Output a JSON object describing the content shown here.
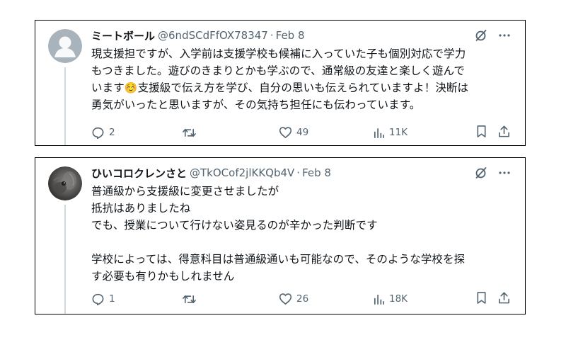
{
  "tweets": [
    {
      "display_name": "ミートボール",
      "handle": "@6ndSCdFfOX78347",
      "separator": "·",
      "date": "Feb 8",
      "text_before_emoji": "現支援担ですが、入学前は支援学校も候補に入っていた子も個別対応で学力\nもつきました。遊びのきまりとかも学ぶので、通常級の友達と楽しく遊んで\nいます",
      "emoji": "☺️",
      "text_after_emoji": "支援級で伝え方を学び、自分の思いも伝えられていますよ！決断は\n勇気がいったと思いますが、その気持ち担任にも伝わっています。",
      "replies": "2",
      "retweets": "",
      "likes": "49",
      "views": "11K",
      "avatar": "default-avatar-icon"
    },
    {
      "display_name": "ひいコロクレンさと",
      "handle": "@TkOCof2jlKKQb4V",
      "separator": "·",
      "date": "Feb 8",
      "text": "普通級から支援級に変更させましたが\n抵抗はありましたね\nでも、授業について行けない姿見るのが辛かった判断です\n\n学校によっては、得意科目は普通級通いも可能なので、そのような学校を探\nす必要も有りかもしれません",
      "replies": "1",
      "retweets": "",
      "likes": "26",
      "views": "18K",
      "avatar": "photo-avatar-icon"
    }
  ],
  "colors": {
    "text": "#0f1419",
    "secondary": "#536471",
    "thread_line": "#cfd9de",
    "border": "#000000"
  }
}
